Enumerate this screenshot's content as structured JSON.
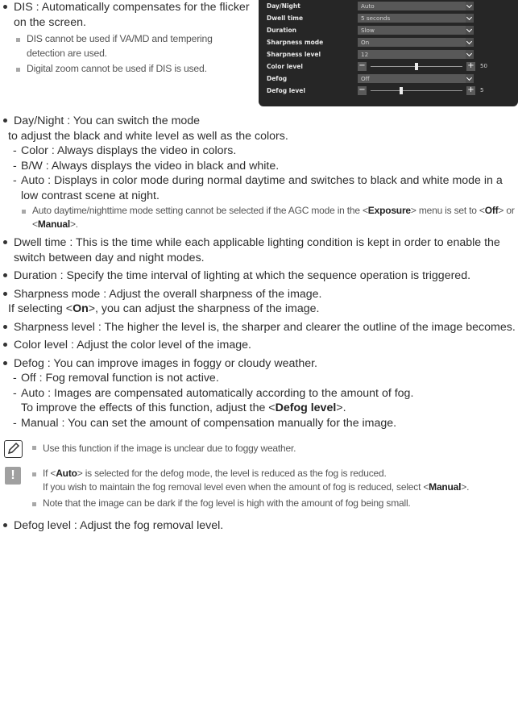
{
  "dis": {
    "title": "DIS : Automatically compensates for the flicker on the screen.",
    "notes": [
      "DIS cannot be used if VA/MD and tempering detection are used.",
      "Digital zoom cannot be used if DIS is used."
    ]
  },
  "osd": {
    "rows": [
      {
        "label": "Day/Night",
        "value": "Auto"
      },
      {
        "label": "Dwell time",
        "value": "5 seconds"
      },
      {
        "label": "Duration",
        "value": "Slow"
      },
      {
        "label": "Sharpness mode",
        "value": "On"
      },
      {
        "label": "Sharpness level",
        "value": "12"
      }
    ],
    "color_level": {
      "label": "Color level",
      "value": "50",
      "level": 50
    },
    "defog": {
      "label": "Defog",
      "value": "Off"
    },
    "defog_level": {
      "label": "Defog level",
      "value": "5",
      "level": 5
    }
  },
  "daynight": {
    "line1": "Day/Night : You can switch the mode",
    "line2": "to adjust the black and white level as well as the colors.",
    "opts": [
      "Color : Always displays the video in colors.",
      "B/W : Always displays the video in black and white.",
      "Auto : Displays in color mode during normal daytime and switches to black and white mode in a low contrast scene at night."
    ],
    "note": {
      "pre": "Auto daytime/nighttime mode setting cannot be selected if the AGC mode in the <",
      "k1": "Exposure",
      "mid1": "> menu is set to <",
      "k2": "Off",
      "mid2": "> or <",
      "k3": "Manual",
      "post": ">."
    }
  },
  "items": {
    "dwell": "Dwell time : This is the time while each applicable lighting condition is kept in order to enable the switch between day and night modes.",
    "duration": "Duration : Specify the time interval of lighting at which the sequence operation is triggered.",
    "sharp_mode_1": "Sharpness mode : Adjust the overall sharpness of the image.",
    "sharp_mode_2_pre": "If selecting <",
    "sharp_mode_2_key": "On",
    "sharp_mode_2_post": ">, you can adjust the sharpness of the image.",
    "sharp_level": "Sharpness level : The higher the level is, the sharper and clearer the outline of the image becomes.",
    "color_level": "Color level : Adjust the color level of the image.",
    "defog": "Defog : You can improve images in foggy or cloudy weather.",
    "defog_off": "Off : Fog removal function is not active.",
    "defog_auto_1": "Auto : Images are compensated automatically according to the amount of fog.",
    "defog_auto_2_pre": "To improve the effects of this function, adjust the <",
    "defog_auto_2_key": "Defog level",
    "defog_auto_2_post": ">.",
    "defog_manual": "Manual : You can set the amount of compensation manually for the image.",
    "defog_level": "Defog level : Adjust the fog removal level."
  },
  "notes": {
    "memo": "Use this function if the image is unclear due to foggy weather.",
    "caution_1_pre": "If <",
    "caution_1_key": "Auto",
    "caution_1_post": "> is selected for the defog mode, the level is reduced as the fog is reduced.",
    "caution_2_pre": "If you wish to maintain the fog removal level even when the amount of fog is reduced, select <",
    "caution_2_key": "Manual",
    "caution_2_post": ">.",
    "caution_3": "Note that the image can be dark if the fog level is high with the amount of fog being small."
  },
  "icons": {
    "memo": "pencil-note-icon",
    "caution": "exclamation-icon"
  }
}
